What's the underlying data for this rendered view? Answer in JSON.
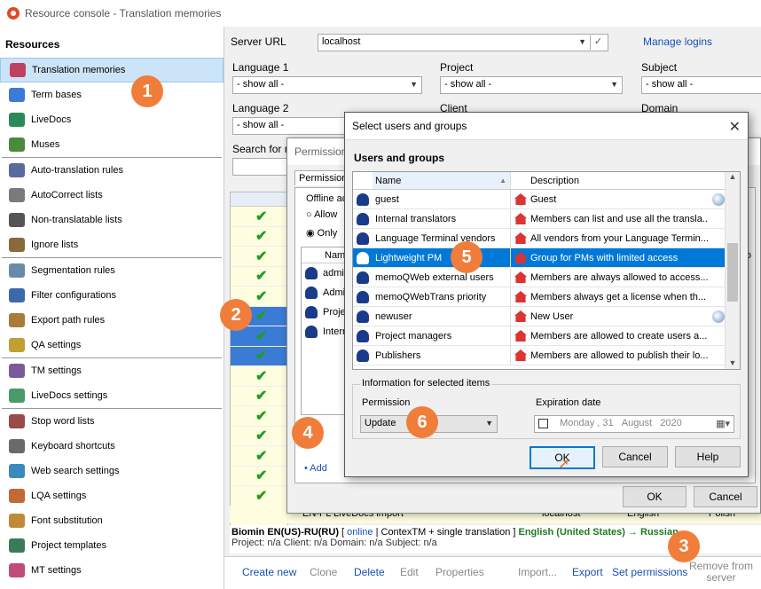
{
  "window": {
    "title": "Resource console - Translation memories"
  },
  "sidebar": {
    "header": "Resources",
    "items": [
      {
        "label": "Translation memories",
        "color": "#c04060"
      },
      {
        "label": "Term bases",
        "color": "#3a7bd5"
      },
      {
        "label": "LiveDocs",
        "color": "#2a8a5a"
      },
      {
        "label": "Muses",
        "color": "#4a8a3a"
      },
      {
        "label": "Auto-translation rules",
        "color": "#5a6a9a"
      },
      {
        "label": "AutoCorrect lists",
        "color": "#7a7a7a"
      },
      {
        "label": "Non-translatable lists",
        "color": "#555555"
      },
      {
        "label": "Ignore lists",
        "color": "#8a6a3a"
      },
      {
        "label": "Segmentation rules",
        "color": "#6a8aaa"
      },
      {
        "label": "Filter configurations",
        "color": "#3a6aaa"
      },
      {
        "label": "Export path rules",
        "color": "#aa7a3a"
      },
      {
        "label": "QA settings",
        "color": "#c0a030"
      },
      {
        "label": "TM settings",
        "color": "#7a5a9a"
      },
      {
        "label": "LiveDocs settings",
        "color": "#4a9a6a"
      },
      {
        "label": "Stop word lists",
        "color": "#9a4a4a"
      },
      {
        "label": "Keyboard shortcuts",
        "color": "#6a6a6a"
      },
      {
        "label": "Web search settings",
        "color": "#3a8ac0"
      },
      {
        "label": "LQA settings",
        "color": "#c06a3a"
      },
      {
        "label": "Font substitution",
        "color": "#c08a3a"
      },
      {
        "label": "Project templates",
        "color": "#3a7a5a"
      },
      {
        "label": "MT settings",
        "color": "#c04a7a"
      }
    ]
  },
  "main": {
    "server_url_label": "Server URL",
    "server_url_value": "localhost",
    "manage_logins": "Manage logins",
    "language1_label": "Language 1",
    "language1_value": "- show all -",
    "project_label": "Project",
    "project_value": "- show all -",
    "subject_label": "Subject",
    "subject_value": "- show all -",
    "language2_label": "Language 2",
    "language2_value": "- show all -",
    "client_label": "Client",
    "domain_label": "Domain",
    "search_label": "Search for na",
    "bottom_row": {
      "name": "EN-PL LiveDocs import",
      "server": "localhost",
      "src": "English",
      "tgt": "Polish"
    },
    "info_line1": {
      "name": "Biomin EN(US)-RU(RU)",
      "mode": "online",
      "type": "ContexTM + single translation",
      "langs": "English (United States) → Russian"
    },
    "info_line2": "Project: n/a   Client: n/a   Domain: n/a   Subject: n/a",
    "toolbar": {
      "create_new": "Create new",
      "clone": "Clone",
      "delete": "Delete",
      "edit": "Edit",
      "properties": "Properties",
      "import": "Import...",
      "export": "Export",
      "set_permissions": "Set permissions",
      "remove_from_server": "Remove from server"
    }
  },
  "permissions_dialog": {
    "title": "Permission",
    "tab": "Permissions",
    "offline_label": "Offline ac",
    "radio_allow": "Allow",
    "radio_only": "Only",
    "name_col": "Nam",
    "rows": [
      "admin",
      "Admin",
      "Projec",
      "Interna"
    ],
    "add_link": "• Add",
    "ok": "OK",
    "cancel": "Cancel",
    "expiration_col": "piratio"
  },
  "select_dialog": {
    "title": "Select users and groups",
    "section_title": "Users and groups",
    "col_name": "Name",
    "col_desc": "Description",
    "rows": [
      {
        "name": "guest",
        "desc": "Guest",
        "globe": true,
        "sel": false
      },
      {
        "name": "Internal translators",
        "desc": "Members can list and use all the transla...",
        "globe": false,
        "sel": false
      },
      {
        "name": "Language Terminal vendors",
        "desc": "All vendors from your Language Termin...",
        "globe": false,
        "sel": false
      },
      {
        "name": "Lightweight PM",
        "desc": "Group for PMs with limited access",
        "globe": false,
        "sel": true
      },
      {
        "name": "memoQWeb external users",
        "desc": "Members are always allowed to access...",
        "globe": false,
        "sel": false
      },
      {
        "name": "memoQWebTrans priority",
        "desc": "Members always get a license when th...",
        "globe": false,
        "sel": false
      },
      {
        "name": "newuser",
        "desc": "New User",
        "globe": true,
        "sel": false
      },
      {
        "name": "Project managers",
        "desc": "Members are allowed to create users a...",
        "globe": false,
        "sel": false
      },
      {
        "name": "Publishers",
        "desc": "Members are allowed to publish their lo...",
        "globe": false,
        "sel": false
      }
    ],
    "info_group_title": "Information for selected items",
    "permission_label": "Permission",
    "permission_value": "Update",
    "expiration_label": "Expiration date",
    "exp_day": "Monday",
    "exp_date": "31",
    "exp_month": "August",
    "exp_year": "2020",
    "ok": "OK",
    "cancel": "Cancel",
    "help": "Help"
  },
  "callouts": [
    "1",
    "2",
    "3",
    "4",
    "5",
    "6"
  ]
}
